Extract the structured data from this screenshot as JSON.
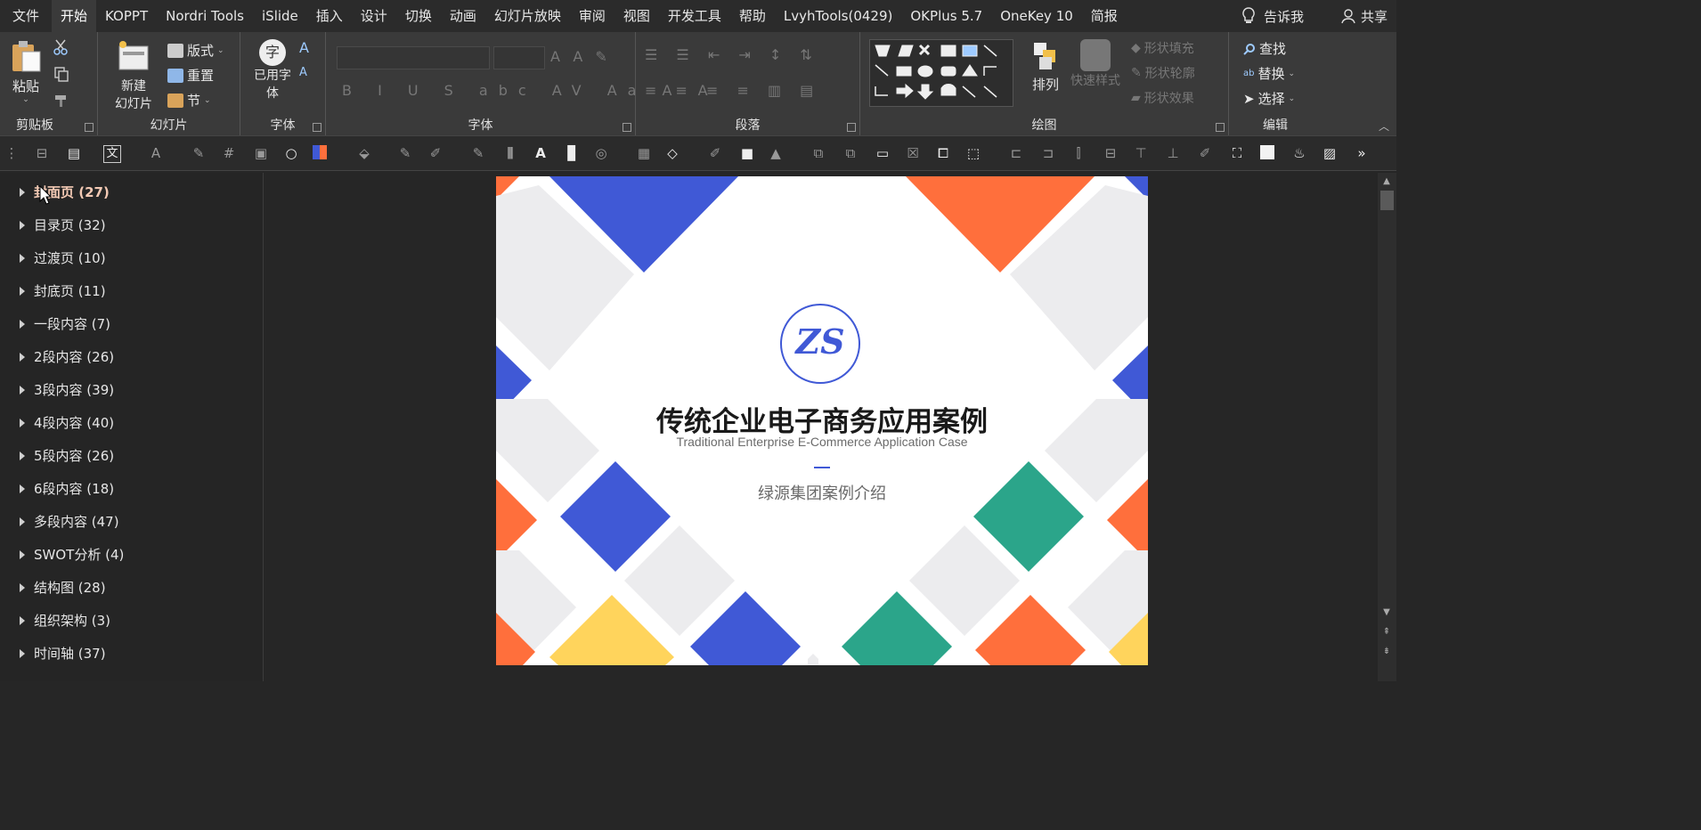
{
  "menubar": {
    "file": "文件",
    "tabs": [
      "开始",
      "KOPPT",
      "Nordri Tools",
      "iSlide",
      "插入",
      "设计",
      "切换",
      "动画",
      "幻灯片放映",
      "审阅",
      "视图",
      "开发工具",
      "帮助",
      "LvyhTools(0429)",
      "OKPlus 5.7",
      "OneKey 10",
      "简报"
    ],
    "active_tab": "开始",
    "tell_me": "告诉我",
    "share": "共享"
  },
  "ribbon": {
    "clipboard": {
      "paste": "粘贴",
      "label": "剪贴板"
    },
    "slides": {
      "new_line1": "新建",
      "new_line2": "幻灯片",
      "layout": "版式",
      "reset": "重置",
      "section": "节",
      "label": "幻灯片"
    },
    "font_small": {
      "used_line1": "已用字",
      "used_line2": "体",
      "label": "字体"
    },
    "font": {
      "label": "字体"
    },
    "paragraph": {
      "label": "段落"
    },
    "drawing": {
      "arrange": "排列",
      "quick_styles": "快速样式",
      "fill": "形状填充",
      "outline": "形状轮廓",
      "effects": "形状效果",
      "label": "绘图"
    },
    "editing": {
      "find": "查找",
      "replace": "替换",
      "select": "选择",
      "label": "编辑"
    }
  },
  "sidebar": {
    "items": [
      {
        "label": "封面页 (27)"
      },
      {
        "label": "目录页 (32)"
      },
      {
        "label": "过渡页 (10)"
      },
      {
        "label": "封底页 (11)"
      },
      {
        "label": "一段内容 (7)"
      },
      {
        "label": "2段内容 (26)"
      },
      {
        "label": "3段内容 (39)"
      },
      {
        "label": "4段内容 (40)"
      },
      {
        "label": "5段内容 (26)"
      },
      {
        "label": "6段内容 (18)"
      },
      {
        "label": "多段内容 (47)"
      },
      {
        "label": "SWOT分析 (4)"
      },
      {
        "label": "结构图 (28)"
      },
      {
        "label": "组织架构 (3)"
      },
      {
        "label": "时间轴 (37)"
      }
    ]
  },
  "slide": {
    "logo_text": "ZS",
    "title": "传统企业电子商务应用案例",
    "subtitle": "Traditional Enterprise E-Commerce Application Case",
    "company": "绿源集团案例介绍",
    "colors": {
      "blue": "#4059d6",
      "orange": "#ff6f3c",
      "green": "#2ba58a",
      "yellow": "#ffd45c",
      "gray": "#ececee"
    }
  }
}
